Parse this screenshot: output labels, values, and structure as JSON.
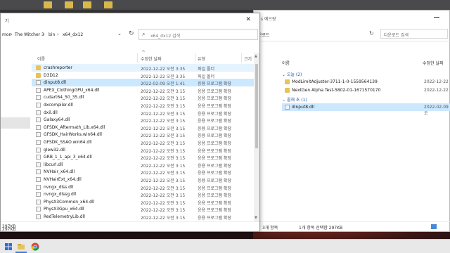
{
  "main_window": {
    "title": "기",
    "breadcrumb": [
      {
        "label": "mon"
      },
      {
        "label": "The Witcher 3"
      },
      {
        "label": "bin"
      },
      {
        "label": "x64_dx12"
      }
    ],
    "search_placeholder": "x64_dx12 검색",
    "columns": {
      "name": "이름",
      "date": "수정한 날짜",
      "type": "유형",
      "size": "크기"
    },
    "rows": [
      {
        "name": "crashreporter",
        "date": "2022-12-22 오전 3:35",
        "type": "파일 폴더",
        "icon": "folder"
      },
      {
        "name": "D3D12",
        "date": "2022-12-22 오전 3:35",
        "type": "파일 폴더",
        "icon": "folder"
      },
      {
        "name": "dinput8.dll",
        "date": "2022-02-09 오전 1:41",
        "type": "응용 프로그램 확장",
        "icon": "dll"
      },
      {
        "name": "APEX_ClothingGPU_x64.dll",
        "date": "2022-12-22 오전 3:15",
        "type": "응용 프로그램 확장",
        "icon": "dll"
      },
      {
        "name": "cudart64_50_35.dll",
        "date": "2022-12-22 오전 3:15",
        "type": "응용 프로그램 확장",
        "icon": "dll"
      },
      {
        "name": "dxcompiler.dll",
        "date": "2022-12-22 오전 3:15",
        "type": "응용 프로그램 확장",
        "icon": "dll"
      },
      {
        "name": "dxil.dll",
        "date": "2022-12-22 오전 3:15",
        "type": "응용 프로그램 확장",
        "icon": "dll"
      },
      {
        "name": "Galaxy64.dll",
        "date": "2022-12-22 오전 3:15",
        "type": "응용 프로그램 확장",
        "icon": "dll"
      },
      {
        "name": "GFSDK_Aftermath_Lib.x64.dll",
        "date": "2022-12-22 오전 3:15",
        "type": "응용 프로그램 확장",
        "icon": "dll"
      },
      {
        "name": "GFSDK_HairWorks.win64.dll",
        "date": "2022-12-22 오전 3:15",
        "type": "응용 프로그램 확장",
        "icon": "dll"
      },
      {
        "name": "GFSDK_SSAO.win64.dll",
        "date": "2022-12-22 오전 3:15",
        "type": "응용 프로그램 확장",
        "icon": "dll"
      },
      {
        "name": "glew32.dll",
        "date": "2022-12-22 오전 3:15",
        "type": "응용 프로그램 확장",
        "icon": "dll"
      },
      {
        "name": "GRB_1_1_api_3_x64.dll",
        "date": "2022-12-22 오전 3:15",
        "type": "응용 프로그램 확장",
        "icon": "dll"
      },
      {
        "name": "libcurl.dll",
        "date": "2022-12-22 오전 3:15",
        "type": "응용 프로그램 확장",
        "icon": "dll"
      },
      {
        "name": "NVHair_x64.dll",
        "date": "2022-12-22 오전 3:15",
        "type": "응용 프로그램 확장",
        "icon": "dll"
      },
      {
        "name": "NVHairExt_x64.dll",
        "date": "2022-12-22 오전 3:15",
        "type": "응용 프로그램 확장",
        "icon": "dll"
      },
      {
        "name": "nvngx_dlss.dll",
        "date": "2022-12-22 오전 3:15",
        "type": "응용 프로그램 확장",
        "icon": "dll"
      },
      {
        "name": "nvngx_dlssg.dll",
        "date": "2022-12-22 오전 3:15",
        "type": "응용 프로그램 확장",
        "icon": "dll"
      },
      {
        "name": "PhysX3Common_x64.dll",
        "date": "2022-12-22 오전 3:15",
        "type": "응용 프로그램 확장",
        "icon": "dll"
      },
      {
        "name": "PhysX3Gpu_x64.dll",
        "date": "2022-12-22 오전 3:15",
        "type": "응용 프로그램 확장",
        "icon": "dll"
      },
      {
        "name": "RedTelemetryLib.dll",
        "date": "2022-12-22 오전 3:15",
        "type": "응용 프로그램 확장",
        "icon": "dll"
      }
    ],
    "status_left": "297KB"
  },
  "right_window": {
    "title": "s 에으랑",
    "address_part": "운로드",
    "search_placeholder": "다운로드 검색",
    "col_name": "이름",
    "col_date": "수정한 날짜",
    "groups": [
      {
        "label": "오늘 (2)"
      },
      {
        "label": "올해 초 (1)"
      }
    ],
    "rows": [
      {
        "name": "ModLimitAdjuster-3711-1-0-1559564139",
        "date": "2022-12-22"
      },
      {
        "name": "NextGen Alpha Test-5802-01-1671570170",
        "date": "2022-12-22"
      },
      {
        "name": "dinput8.dll",
        "date": "2022-02-09 오"
      }
    ],
    "status_items": "3개 항목",
    "status_selected": "1개 항목 선택함 297KB"
  },
  "colors": {
    "selection": "#cce8ff",
    "hover": "#e5f3ff",
    "folder": "#e8c25a",
    "accent": "#3a7bd5"
  },
  "taskbar": {
    "icons": [
      "windows-start-icon",
      "file-explorer-icon",
      "chrome-icon"
    ]
  }
}
